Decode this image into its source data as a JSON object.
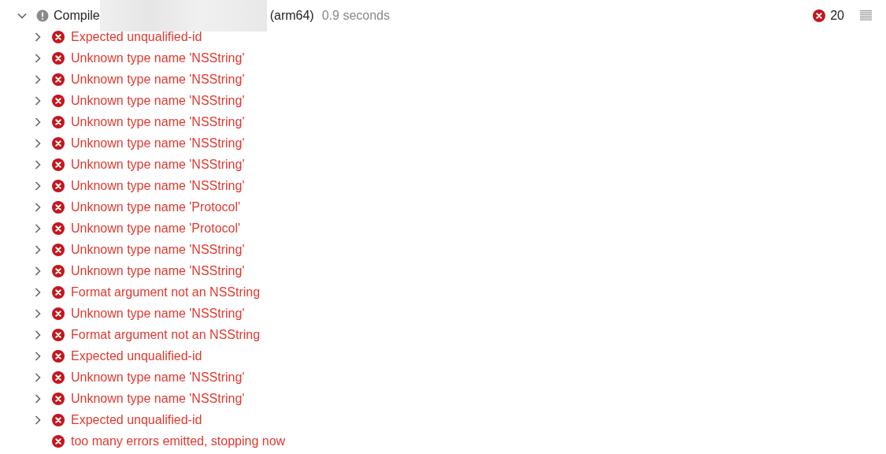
{
  "group": {
    "title": "Compile",
    "arch": "(arm64)",
    "duration": "0.9 seconds",
    "expanded": true,
    "redacted": true,
    "error_count": "20"
  },
  "issues": [
    {
      "text": "Expected unqualified-id",
      "expandable": true
    },
    {
      "text": "Unknown type name 'NSString'",
      "expandable": true
    },
    {
      "text": "Unknown type name 'NSString'",
      "expandable": true
    },
    {
      "text": "Unknown type name 'NSString'",
      "expandable": true
    },
    {
      "text": "Unknown type name 'NSString'",
      "expandable": true
    },
    {
      "text": "Unknown type name 'NSString'",
      "expandable": true
    },
    {
      "text": "Unknown type name 'NSString'",
      "expandable": true
    },
    {
      "text": "Unknown type name 'NSString'",
      "expandable": true
    },
    {
      "text": "Unknown type name 'Protocol'",
      "expandable": true
    },
    {
      "text": "Unknown type name 'Protocol'",
      "expandable": true
    },
    {
      "text": "Unknown type name 'NSString'",
      "expandable": true
    },
    {
      "text": "Unknown type name 'NSString'",
      "expandable": true
    },
    {
      "text": "Format argument not an NSString",
      "expandable": true
    },
    {
      "text": "Unknown type name 'NSString'",
      "expandable": true
    },
    {
      "text": "Format argument not an NSString",
      "expandable": true
    },
    {
      "text": "Expected unqualified-id",
      "expandable": true
    },
    {
      "text": "Unknown type name 'NSString'",
      "expandable": true
    },
    {
      "text": "Unknown type name 'NSString'",
      "expandable": true
    },
    {
      "text": "Expected unqualified-id",
      "expandable": true
    },
    {
      "text": "too many errors emitted, stopping now",
      "expandable": false
    }
  ]
}
